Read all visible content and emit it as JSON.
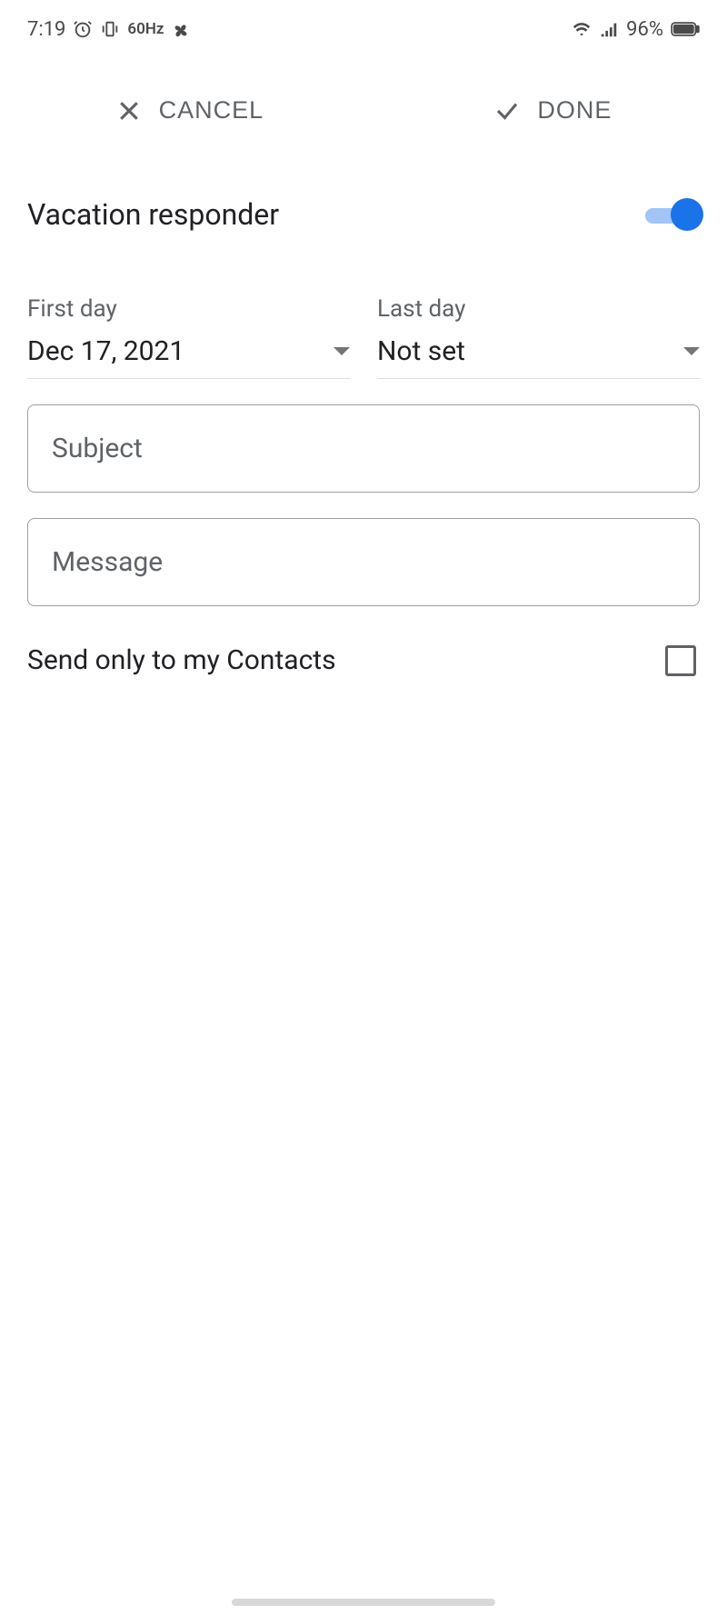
{
  "status_bar": {
    "time": "7:19",
    "refresh_rate": "60Hz",
    "battery_percent": "96%"
  },
  "actions": {
    "cancel_label": "CANCEL",
    "done_label": "DONE"
  },
  "setting": {
    "title": "Vacation responder",
    "enabled": true
  },
  "dates": {
    "first_day_label": "First day",
    "first_day_value": "Dec 17, 2021",
    "last_day_label": "Last day",
    "last_day_value": "Not set"
  },
  "fields": {
    "subject_placeholder": "Subject",
    "subject_value": "",
    "message_placeholder": "Message",
    "message_value": ""
  },
  "checkbox": {
    "label": "Send only to my Contacts",
    "checked": false
  }
}
